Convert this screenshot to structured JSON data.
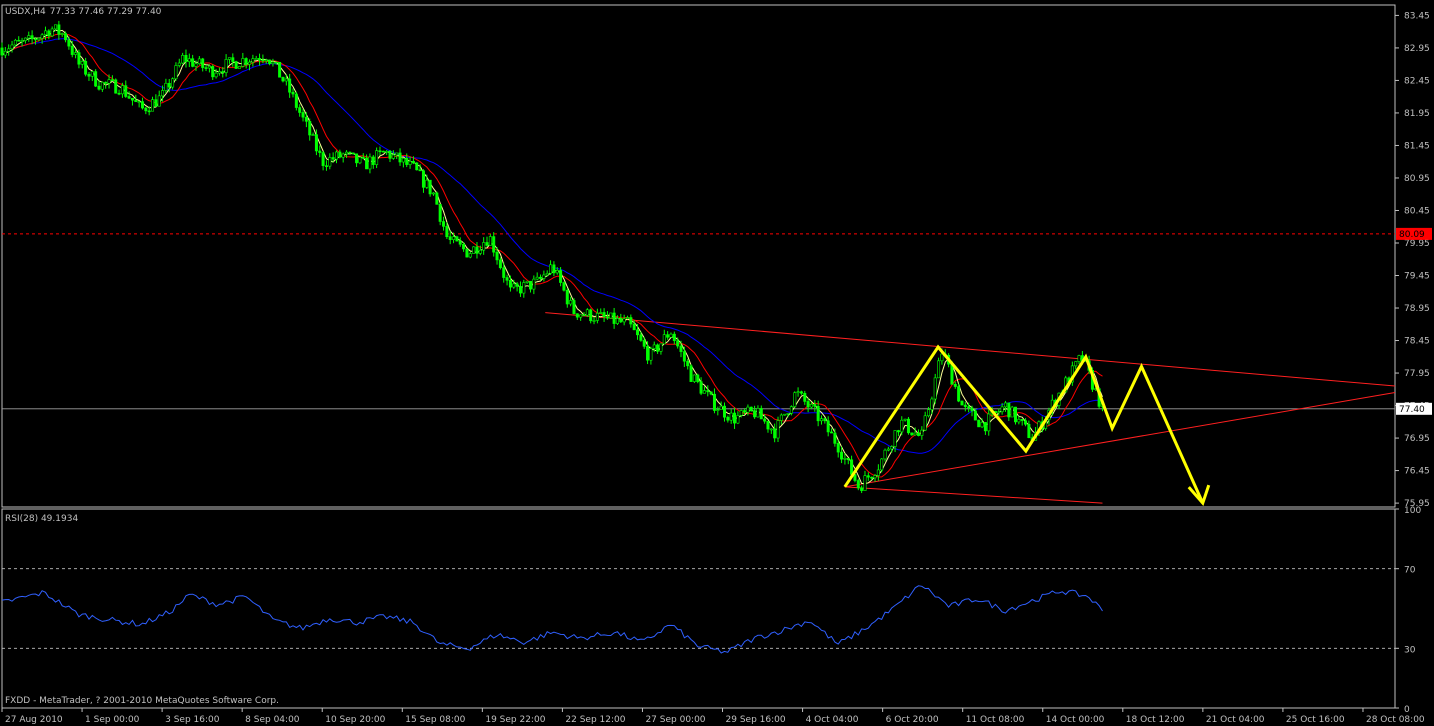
{
  "header": {
    "title": "USDX,H4",
    "ohlc": "77.33 77.46 77.29 77.40"
  },
  "footer": {
    "copyright": "FXDD - MetaTrader, ? 2001-2010 MetaQuotes Software Corp."
  },
  "colors": {
    "background": "#000000",
    "frame": "#c0c0c0",
    "bull_candle": "#00ff00",
    "ma_fast": "#ffff99",
    "ma_mid": "#ff0000",
    "ma_slow": "#0000ff",
    "trendline": "#ff2020",
    "pattern": "#ffff00",
    "rsi": "#3060ff",
    "hline_red": "#ff0000",
    "price_marker_red": "#ff0000",
    "price_marker_white": "#ffffff"
  },
  "chart_data": [
    {
      "type": "candlestick",
      "title": "USDX,H4",
      "y_ticks": [
        "83.45",
        "82.95",
        "82.45",
        "81.95",
        "81.45",
        "80.95",
        "80.45",
        "79.95",
        "79.45",
        "78.95",
        "78.45",
        "77.95",
        "77.45",
        "76.95",
        "76.45",
        "75.95"
      ],
      "ylim": [
        75.89,
        83.61
      ],
      "x_ticks": [
        "27 Aug 2010",
        "1 Sep 00:00",
        "3 Sep 16:00",
        "8 Sep 04:00",
        "10 Sep 20:00",
        "15 Sep 08:00",
        "19 Sep 22:00",
        "22 Sep 12:00",
        "27 Sep 00:00",
        "29 Sep 16:00",
        "4 Oct 04:00",
        "6 Oct 20:00",
        "11 Oct 08:00",
        "14 Oct 00:00",
        "18 Oct 12:00",
        "21 Oct 04:00",
        "25 Oct 16:00",
        "28 Oct 08:00"
      ],
      "price_path": [
        {
          "t": 0.0,
          "p": 82.95
        },
        {
          "t": 0.02,
          "p": 83.05
        },
        {
          "t": 0.035,
          "p": 83.25
        },
        {
          "t": 0.045,
          "p": 83.15
        },
        {
          "t": 0.055,
          "p": 82.7
        },
        {
          "t": 0.07,
          "p": 82.4
        },
        {
          "t": 0.085,
          "p": 82.35
        },
        {
          "t": 0.1,
          "p": 82.0
        },
        {
          "t": 0.115,
          "p": 82.2
        },
        {
          "t": 0.13,
          "p": 82.8
        },
        {
          "t": 0.15,
          "p": 82.6
        },
        {
          "t": 0.17,
          "p": 82.75
        },
        {
          "t": 0.19,
          "p": 82.85
        },
        {
          "t": 0.205,
          "p": 82.35
        },
        {
          "t": 0.215,
          "p": 81.9
        },
        {
          "t": 0.23,
          "p": 81.2
        },
        {
          "t": 0.245,
          "p": 81.3
        },
        {
          "t": 0.26,
          "p": 81.15
        },
        {
          "t": 0.275,
          "p": 81.35
        },
        {
          "t": 0.295,
          "p": 81.1
        },
        {
          "t": 0.31,
          "p": 80.7
        },
        {
          "t": 0.32,
          "p": 80.0
        },
        {
          "t": 0.335,
          "p": 79.8
        },
        {
          "t": 0.35,
          "p": 80.05
        },
        {
          "t": 0.365,
          "p": 79.2
        },
        {
          "t": 0.385,
          "p": 79.35
        },
        {
          "t": 0.395,
          "p": 79.6
        },
        {
          "t": 0.41,
          "p": 78.9
        },
        {
          "t": 0.43,
          "p": 78.8
        },
        {
          "t": 0.45,
          "p": 78.7
        },
        {
          "t": 0.465,
          "p": 78.2
        },
        {
          "t": 0.48,
          "p": 78.6
        },
        {
          "t": 0.495,
          "p": 77.9
        },
        {
          "t": 0.51,
          "p": 77.5
        },
        {
          "t": 0.525,
          "p": 77.25
        },
        {
          "t": 0.54,
          "p": 77.35
        },
        {
          "t": 0.555,
          "p": 77.05
        },
        {
          "t": 0.57,
          "p": 77.65
        },
        {
          "t": 0.585,
          "p": 77.3
        },
        {
          "t": 0.6,
          "p": 76.85
        },
        {
          "t": 0.615,
          "p": 76.2
        },
        {
          "t": 0.63,
          "p": 76.55
        },
        {
          "t": 0.645,
          "p": 77.2
        },
        {
          "t": 0.66,
          "p": 76.95
        },
        {
          "t": 0.675,
          "p": 78.3
        },
        {
          "t": 0.69,
          "p": 77.4
        },
        {
          "t": 0.705,
          "p": 77.15
        },
        {
          "t": 0.72,
          "p": 77.45
        },
        {
          "t": 0.74,
          "p": 76.95
        },
        {
          "t": 0.755,
          "p": 77.5
        },
        {
          "t": 0.775,
          "p": 78.2
        },
        {
          "t": 0.79,
          "p": 77.4
        }
      ],
      "horizontal_line": 80.09,
      "current_price": 77.4,
      "trendlines": [
        {
          "from": [
            0.39,
            78.88
          ],
          "to": [
            1.0,
            77.75
          ]
        },
        {
          "from": [
            0.605,
            76.2
          ],
          "to": [
            1.0,
            77.65
          ]
        },
        {
          "from": [
            0.605,
            76.2
          ],
          "to": [
            0.79,
            75.95
          ]
        }
      ],
      "zigzag": [
        {
          "t": 0.605,
          "p": 76.2
        },
        {
          "t": 0.672,
          "p": 78.35
        },
        {
          "t": 0.735,
          "p": 76.75
        },
        {
          "t": 0.778,
          "p": 78.2
        },
        {
          "t": 0.797,
          "p": 77.1
        },
        {
          "t": 0.818,
          "p": 78.05
        },
        {
          "t": 0.862,
          "p": 75.95
        }
      ],
      "price_markers": [
        "80.09",
        "77.40"
      ]
    },
    {
      "type": "line",
      "title": "RSI(28) 49.1934",
      "y_ticks": [
        "100",
        "70",
        "30",
        "0"
      ],
      "ylim": [
        0,
        100
      ],
      "levels": [
        70,
        30
      ],
      "rsi_path": [
        {
          "t": 0.0,
          "v": 53
        },
        {
          "t": 0.03,
          "v": 58
        },
        {
          "t": 0.055,
          "v": 47
        },
        {
          "t": 0.08,
          "v": 44
        },
        {
          "t": 0.1,
          "v": 42
        },
        {
          "t": 0.12,
          "v": 48
        },
        {
          "t": 0.135,
          "v": 57
        },
        {
          "t": 0.155,
          "v": 52
        },
        {
          "t": 0.175,
          "v": 56
        },
        {
          "t": 0.195,
          "v": 44
        },
        {
          "t": 0.215,
          "v": 40
        },
        {
          "t": 0.235,
          "v": 45
        },
        {
          "t": 0.255,
          "v": 43
        },
        {
          "t": 0.275,
          "v": 46
        },
        {
          "t": 0.295,
          "v": 43
        },
        {
          "t": 0.315,
          "v": 32
        },
        {
          "t": 0.335,
          "v": 30
        },
        {
          "t": 0.355,
          "v": 37
        },
        {
          "t": 0.375,
          "v": 33
        },
        {
          "t": 0.395,
          "v": 38
        },
        {
          "t": 0.415,
          "v": 35
        },
        {
          "t": 0.44,
          "v": 38
        },
        {
          "t": 0.46,
          "v": 33
        },
        {
          "t": 0.48,
          "v": 42
        },
        {
          "t": 0.5,
          "v": 31
        },
        {
          "t": 0.52,
          "v": 28
        },
        {
          "t": 0.54,
          "v": 35
        },
        {
          "t": 0.56,
          "v": 39
        },
        {
          "t": 0.58,
          "v": 44
        },
        {
          "t": 0.6,
          "v": 32
        },
        {
          "t": 0.62,
          "v": 40
        },
        {
          "t": 0.64,
          "v": 50
        },
        {
          "t": 0.66,
          "v": 62
        },
        {
          "t": 0.68,
          "v": 51
        },
        {
          "t": 0.7,
          "v": 55
        },
        {
          "t": 0.72,
          "v": 49
        },
        {
          "t": 0.74,
          "v": 54
        },
        {
          "t": 0.76,
          "v": 59
        },
        {
          "t": 0.78,
          "v": 56
        },
        {
          "t": 0.79,
          "v": 49
        }
      ]
    }
  ]
}
